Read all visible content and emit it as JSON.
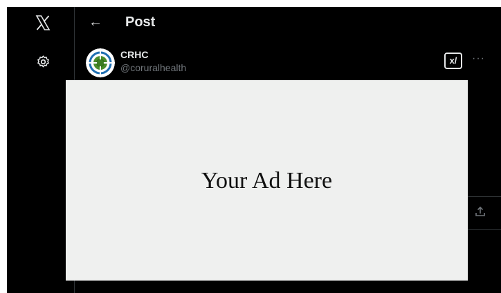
{
  "header": {
    "back_icon": "←",
    "title": "Post"
  },
  "sidebar": {
    "logo": "X",
    "settings_icon": "gear-icon"
  },
  "post": {
    "author_name": "CRHC",
    "author_handle": "@coruralhealth",
    "grok_icon": "x/",
    "more_icon": "···",
    "share_icon": "share-icon"
  },
  "ad": {
    "text": "Your Ad Here"
  },
  "colors": {
    "background": "#000000",
    "text": "#e7e9ea",
    "muted": "#71767b",
    "ad_bg": "#eff0ef"
  }
}
